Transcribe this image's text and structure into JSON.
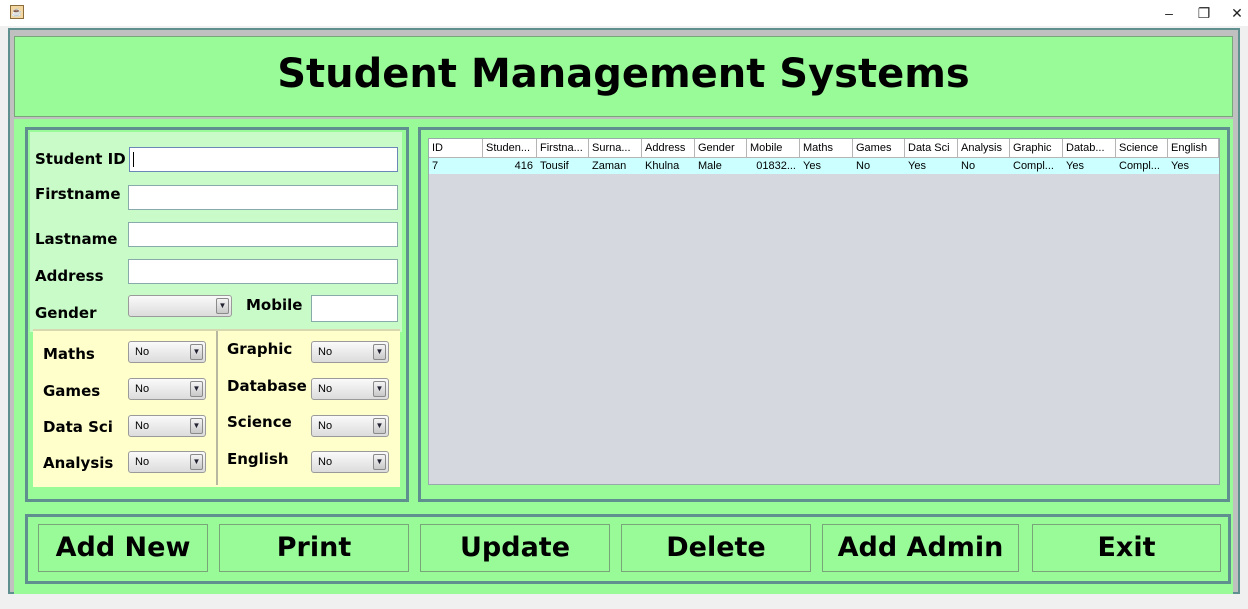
{
  "window": {
    "controls": {
      "minimize": "–",
      "maximize": "❐",
      "close": "✕"
    }
  },
  "header": {
    "title": "Student Management Systems"
  },
  "form": {
    "student_id_label": "Student ID",
    "firstname_label": "Firstname",
    "lastname_label": "Lastname",
    "address_label": "Address",
    "gender_label": "Gender",
    "mobile_label": "Mobile",
    "student_id_value": "",
    "firstname_value": "",
    "lastname_value": "",
    "address_value": "",
    "gender_value": "",
    "mobile_value": ""
  },
  "subjects": {
    "maths": {
      "label": "Maths",
      "value": "No"
    },
    "games": {
      "label": "Games",
      "value": "No"
    },
    "data_sci": {
      "label": "Data Sci",
      "value": "No"
    },
    "analysis": {
      "label": "Analysis",
      "value": "No"
    },
    "graphic": {
      "label": "Graphic",
      "value": "No"
    },
    "database": {
      "label": "Database",
      "value": "No"
    },
    "science": {
      "label": "Science",
      "value": "No"
    },
    "english": {
      "label": "English",
      "value": "No"
    }
  },
  "table": {
    "columns": [
      "ID",
      "Studen...",
      "Firstna...",
      "Surna...",
      "Address",
      "Gender",
      "Mobile",
      "Maths",
      "Games",
      "Data Sci",
      "Analysis",
      "Graphic",
      "Datab...",
      "Science",
      "English"
    ],
    "rows": [
      [
        "7",
        "416",
        "Tousif",
        "Zaman",
        "Khulna",
        "Male",
        "01832...",
        "Yes",
        "No",
        "Yes",
        "No",
        "Compl...",
        "Yes",
        "Compl...",
        "Yes"
      ]
    ]
  },
  "buttons": {
    "add_new": "Add New",
    "print": "Print",
    "update": "Update",
    "delete": "Delete",
    "add_admin": "Add Admin",
    "exit": "Exit"
  },
  "icons": {
    "app": "java-cup-icon",
    "dropdown": "chevron-down-icon"
  }
}
